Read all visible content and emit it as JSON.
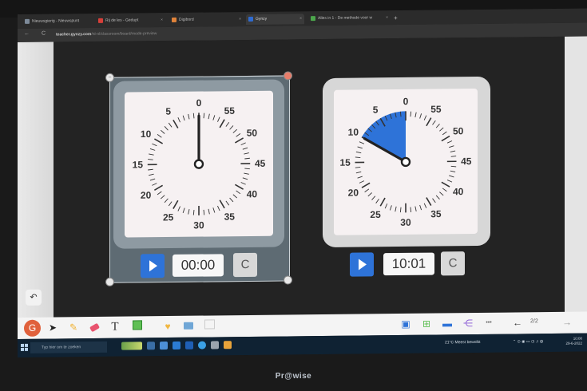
{
  "browser": {
    "tabs": [
      {
        "label": "Nieuwsgierig - Nieuwspunt",
        "color": "#7d8a99"
      },
      {
        "label": "Rij de les - Gedupt",
        "color": "#d7403a"
      },
      {
        "label": "Digibord",
        "color": "#e0833a"
      },
      {
        "label": "Gynzy",
        "color": "#2f6bd1"
      },
      {
        "label": "Alles in 1 - De methode voor w",
        "color": "#4ca64c"
      }
    ],
    "new_tab": "+",
    "url_host": "teacher.gynzy.com",
    "url_path": "/nl-nl/classroom/board/mode-preview",
    "back": "←",
    "reload": "C"
  },
  "timers": [
    {
      "display": "00:00",
      "minutes_set": 0,
      "numbers": [
        "0",
        "5",
        "10",
        "15",
        "20",
        "25",
        "30",
        "35",
        "40",
        "45",
        "50",
        "55"
      ],
      "frame_color": "#8e9aa2",
      "reset_symbol": "C"
    },
    {
      "display": "10:01",
      "minutes_set": 10,
      "numbers": [
        "0",
        "5",
        "10",
        "15",
        "20",
        "25",
        "30",
        "35",
        "40",
        "45",
        "50",
        "55"
      ],
      "frame_color": "#d7d7d7",
      "wedge_color": "#2e73d8",
      "reset_symbol": "C"
    }
  ],
  "toolbar": {
    "avatar_letter": "G",
    "tools": [
      "pointer-icon",
      "pen-icon",
      "eraser-icon",
      "text-icon",
      "select-icon",
      "heart-icon",
      "image-icon",
      "layout-icon"
    ],
    "text_tool": "T",
    "page_indicator": "2/2",
    "more": "•••"
  },
  "taskbar": {
    "search_placeholder": "Typ hier om te zoeken",
    "weather": "21°C  Meest bewolkt",
    "time": "10:00",
    "date": "29-6-2022"
  },
  "monitor_brand": "Pr@wise",
  "undo_symbol": "↶"
}
